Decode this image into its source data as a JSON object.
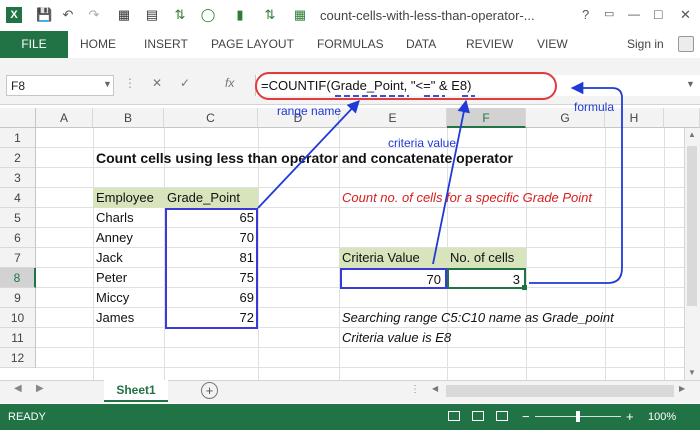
{
  "titlebar": {
    "app_icon": "excel-icon",
    "title": "count-cells-with-less-than-operator-...",
    "help": "?",
    "minimize": "—",
    "restore": "□",
    "close": "✕"
  },
  "ribbon": {
    "file": "FILE",
    "tabs": [
      "HOME",
      "INSERT",
      "PAGE LAYOUT",
      "FORMULAS",
      "DATA",
      "REVIEW",
      "VIEW"
    ],
    "signin": "Sign in"
  },
  "formula_bar": {
    "cell_ref": "F8",
    "formula": "=COUNTIF(Grade_Point, \"<=\" & E8)",
    "fx": "fx"
  },
  "columns": [
    "A",
    "B",
    "C",
    "D",
    "E",
    "F",
    "G",
    "H"
  ],
  "rows": [
    "1",
    "2",
    "3",
    "4",
    "5",
    "6",
    "7",
    "8",
    "9",
    "10",
    "11",
    "12"
  ],
  "sheet": {
    "heading": "Count cells using less than operator and concatenate operator",
    "employee_header": "Employee",
    "grade_header": "Grade_Point",
    "employees": [
      {
        "name": "Charls",
        "grade": "65"
      },
      {
        "name": "Anney",
        "grade": "70"
      },
      {
        "name": "Jack",
        "grade": "81"
      },
      {
        "name": "Peter",
        "grade": "75"
      },
      {
        "name": "Miccy",
        "grade": "69"
      },
      {
        "name": "James",
        "grade": "72"
      }
    ],
    "note_red": "Count no. of cells for a specific Grade Point",
    "criteria_header": "Criteria Value",
    "count_header": "No. of cells",
    "criteria_value": "70",
    "count_value": "3",
    "note_range": "Searching range C5:C10 name as Grade_point",
    "note_criteria": "Criteria value is E8"
  },
  "annotations": {
    "range_name": "range name",
    "criteria_value": "criteria value",
    "formula": "formula"
  },
  "sheet_tabs": {
    "active": "Sheet1",
    "add": "+"
  },
  "status": {
    "ready": "READY",
    "zoom": "100%",
    "minus": "−",
    "plus": "+"
  },
  "colors": {
    "accent": "#217346",
    "header_fill": "#d8e4bc",
    "annotation": "#1f3ad6",
    "highlight": "#e23b3b"
  }
}
